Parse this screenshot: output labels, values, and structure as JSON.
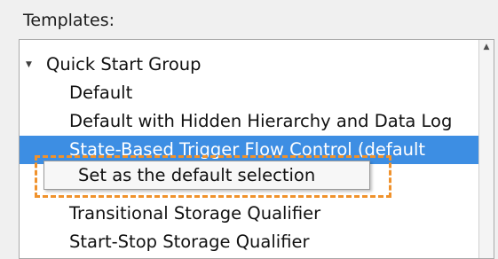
{
  "templates_label": "Templates:",
  "tree": {
    "group_label": "Quick Start Group",
    "items": [
      "Default",
      "Default with Hidden Hierarchy and Data Log",
      "State-Based Trigger Flow Control (default",
      "",
      "Transitional Storage Qualifier",
      "Start-Stop Storage Qualifier"
    ],
    "selected_index": 2
  },
  "context_menu": {
    "item_label": "Set as the default selection"
  },
  "colors": {
    "selection": "#3d8ee3",
    "highlight_outline": "#f0922c"
  },
  "icons": {
    "expander": "triangle-down-icon",
    "scroll_up": "arrow-up-icon"
  }
}
